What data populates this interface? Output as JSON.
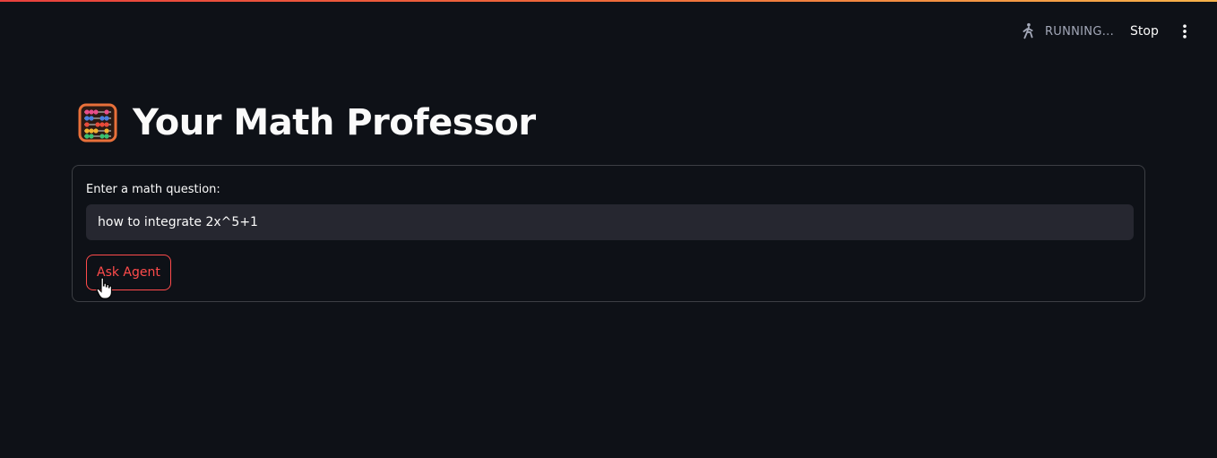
{
  "toolbar": {
    "status_text": "RUNNING...",
    "status_icon": "running-person-icon",
    "stop_label": "Stop",
    "menu_icon": "vertical-ellipsis-icon"
  },
  "header": {
    "icon": "abacus-icon",
    "title": "Your Math Professor"
  },
  "form": {
    "label": "Enter a math question:",
    "input_value": "how to integrate 2x^5+1",
    "button_label": "Ask Agent"
  },
  "colors": {
    "background": "#0e1117",
    "input_bg": "#262730",
    "accent": "#ff4b4b",
    "text": "#fafafa",
    "muted": "#a3a8b8"
  }
}
